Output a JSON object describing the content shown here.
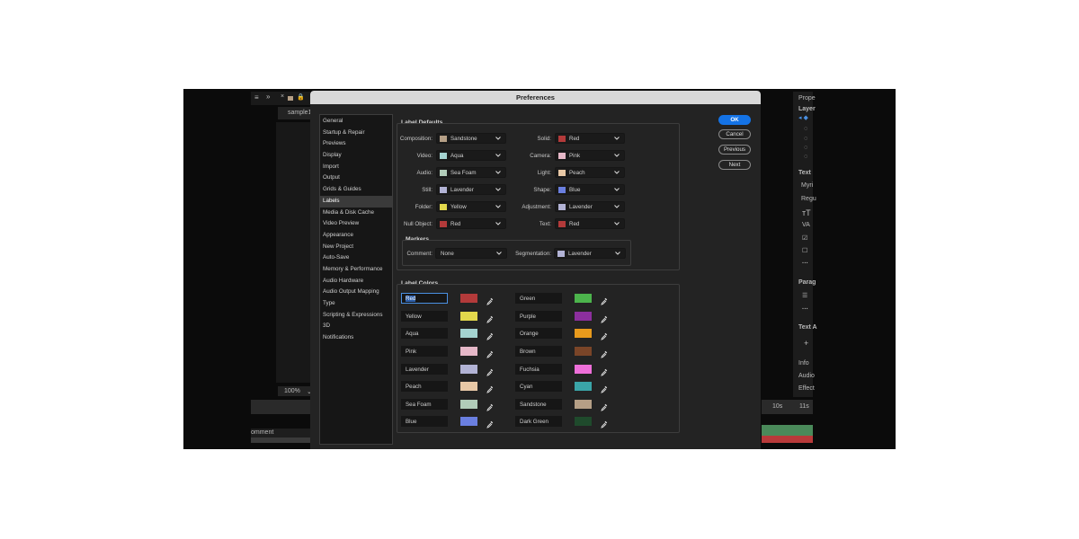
{
  "background": {
    "tab_label": "sample1",
    "zoom_label": "100%",
    "comment_label": "omment",
    "right_panel": [
      "Prope",
      "Layer",
      "Text",
      "Myri",
      "Regu",
      "Parag",
      "Text A",
      "Info",
      "Audio",
      "Effect"
    ],
    "timeline_marks": [
      "10s",
      "11s"
    ]
  },
  "dialog": {
    "title": "Preferences",
    "categories": [
      "General",
      "Startup & Repair",
      "Previews",
      "Display",
      "Import",
      "Output",
      "Grids & Guides",
      "Labels",
      "Media & Disk Cache",
      "Video Preview",
      "Appearance",
      "New Project",
      "Auto-Save",
      "Memory & Performance",
      "Audio Hardware",
      "Audio Output Mapping",
      "Type",
      "Scripting & Expressions",
      "3D",
      "Notifications"
    ],
    "selected_category": "Labels",
    "buttons": {
      "ok": "OK",
      "cancel": "Cancel",
      "previous": "Previous",
      "next": "Next"
    },
    "label_defaults": {
      "title": "Label Defaults",
      "left": [
        {
          "label": "Composition:",
          "value": "Sandstone",
          "color": "#b59f86"
        },
        {
          "label": "Video:",
          "value": "Aqua",
          "color": "#a4d3d0"
        },
        {
          "label": "Audio:",
          "value": "Sea Foam",
          "color": "#b1ccb9"
        },
        {
          "label": "Still:",
          "value": "Lavender",
          "color": "#b2b3d5"
        },
        {
          "label": "Folder:",
          "value": "Yellow",
          "color": "#e2d84c"
        },
        {
          "label": "Null Object:",
          "value": "Red",
          "color": "#b33a3a"
        }
      ],
      "right": [
        {
          "label": "Solid:",
          "value": "Red",
          "color": "#b33a3a"
        },
        {
          "label": "Camera:",
          "value": "Pink",
          "color": "#e6b8c8"
        },
        {
          "label": "Light:",
          "value": "Peach",
          "color": "#e8c8a6"
        },
        {
          "label": "Shape:",
          "value": "Blue",
          "color": "#6a7fe0"
        },
        {
          "label": "Adjustment:",
          "value": "Lavender",
          "color": "#b2b3d5"
        },
        {
          "label": "Text:",
          "value": "Red",
          "color": "#b33a3a"
        }
      ],
      "markers": {
        "title": "Markers",
        "comment": {
          "label": "Comment:",
          "value": "None"
        },
        "segmentation": {
          "label": "Segmentation:",
          "value": "Lavender",
          "color": "#b2b3d5"
        }
      }
    },
    "label_colors": {
      "title": "Label Colors",
      "left": [
        {
          "name": "Red",
          "color": "#b33a3a"
        },
        {
          "name": "Yellow",
          "color": "#e2d84c"
        },
        {
          "name": "Aqua",
          "color": "#a4d3d0"
        },
        {
          "name": "Pink",
          "color": "#e6b8c8"
        },
        {
          "name": "Lavender",
          "color": "#b2b3d5"
        },
        {
          "name": "Peach",
          "color": "#e8c8a6"
        },
        {
          "name": "Sea Foam",
          "color": "#b1ccb9"
        },
        {
          "name": "Blue",
          "color": "#6a7fe0"
        }
      ],
      "right": [
        {
          "name": "Green",
          "color": "#4cb44c"
        },
        {
          "name": "Purple",
          "color": "#8c2f9e"
        },
        {
          "name": "Orange",
          "color": "#e89a1c"
        },
        {
          "name": "Brown",
          "color": "#7a4528"
        },
        {
          "name": "Fuchsia",
          "color": "#ee6fd9"
        },
        {
          "name": "Cyan",
          "color": "#3aa5a8"
        },
        {
          "name": "Sandstone",
          "color": "#b59f86"
        },
        {
          "name": "Dark Green",
          "color": "#1f4a2c"
        }
      ]
    }
  }
}
